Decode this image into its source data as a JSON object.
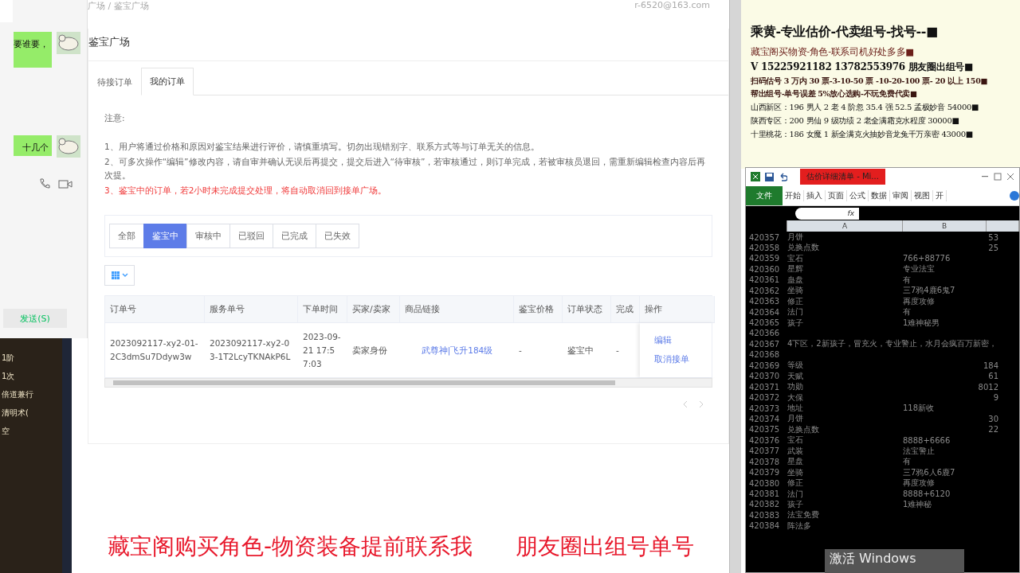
{
  "chat": {
    "messages": [
      {
        "text": "要谁要，"
      },
      {
        "text": "十几个"
      }
    ],
    "send_button": "发送(S)"
  },
  "game_panel": {
    "lines": [
      "1阶",
      "1次",
      "倍道兼行",
      "清明术(",
      "空"
    ]
  },
  "browser": {
    "breadcrumb": "广场 / 鉴宝广场",
    "user_email": "r-6520@163.com",
    "page_title": "鉴宝广场",
    "tabs": [
      {
        "label": "待接订单",
        "selected": false
      },
      {
        "label": "我的订单",
        "selected": true
      }
    ],
    "notice": {
      "heading": "注意:",
      "lines": [
        {
          "text": "1、用户将通过价格和原因对鉴宝结果进行评价，请慎重填写。切勿出现错别字、联系方式等与订单无关的信息。",
          "warning": false
        },
        {
          "text": "2、可多次操作“编辑”修改内容，请自审并确认无误后再提交，提交后进入“待审核”，若审核通过，则订单完成，若被审核员退回，需重新编辑检查内容后再次提。",
          "warning": false
        },
        {
          "text": "3、鉴宝中的订单，若2小时未完成提交处理，将自动取消回到接单广场。",
          "warning": true
        }
      ]
    },
    "filters": [
      {
        "label": "全部",
        "selected": false
      },
      {
        "label": "鉴宝中",
        "selected": true
      },
      {
        "label": "审核中",
        "selected": false
      },
      {
        "label": "已驳回",
        "selected": false
      },
      {
        "label": "已完成",
        "selected": false
      },
      {
        "label": "已失效",
        "selected": false
      }
    ],
    "table": {
      "columns": [
        "订单号",
        "服务单号",
        "下单时间",
        "买家/卖家",
        "商品链接",
        "鉴宝价格",
        "订单状态",
        "完成",
        "操作"
      ],
      "rows": [
        {
          "order_no": "2023092117-xy2-01-2C3dmSu7Ddyw3w",
          "service_no": "2023092117-xy2-03-1T2LcyTKNAkP6L",
          "time": "2023-09-21 17:57:03",
          "role": "卖家身份",
          "link": "武尊神|飞升184级",
          "price": "-",
          "status": "鉴宝中",
          "done": "-",
          "actions": [
            "编辑",
            "取消接单"
          ]
        }
      ]
    }
  },
  "ad_panel": {
    "lines": [
      {
        "text": "乘黄-专业估价-代卖组号-找号--■",
        "kind": "title"
      },
      {
        "text": "藏宝阁买物资-角色-联系司机好处多多■",
        "kind": "accent"
      },
      {
        "text": "V 15225921182   13782553976 朋友圈出组号■",
        "kind": "bold"
      },
      {
        "text": "扫码估号 3 万内 30 票-3-10-50 票 -10-20-100 票- 20 以上 150■",
        "kind": "small"
      },
      {
        "text": "帮出组号-单号误差 5%放心选购-不玩免费代卖■",
        "kind": "small"
      },
      {
        "text": "山西新区：196 男人 2 老 4 阶忽 35.4 强 52.5 孟极妙音 54000■",
        "kind": "plain"
      },
      {
        "text": "陕西专区：200 男仙 9 级功绩 2 老全满霜克水程度 30000■",
        "kind": "plain"
      },
      {
        "text": "十里桃花：186 女魔 1 新全满克火抽妙音龙兔千万亲密 43000■",
        "kind": "plain"
      }
    ]
  },
  "spreadsheet": {
    "title": "估价详细清单 - Mi...",
    "file_tab": "文件",
    "ribbon_tabs": [
      "开始",
      "插入",
      "页面",
      "公式",
      "数据",
      "审阅",
      "视图",
      "开"
    ],
    "formula_label": "fx",
    "columns": [
      "A",
      "B"
    ],
    "rows": [
      {
        "num": "420357",
        "a": "月饼",
        "b": "53",
        "kind": "number"
      },
      {
        "num": "420358",
        "a": "兑换点数",
        "b": "25",
        "kind": "number"
      },
      {
        "num": "420359",
        "a": "宝石",
        "b": "766+88776",
        "kind": "text"
      },
      {
        "num": "420360",
        "a": "星辉",
        "b": "专业法宝",
        "kind": "text"
      },
      {
        "num": "420361",
        "a": "蛊盘",
        "b": "有",
        "kind": "text"
      },
      {
        "num": "420362",
        "a": "坐骑",
        "b": "三7鸦4鹿6鬼7",
        "kind": "text"
      },
      {
        "num": "420363",
        "a": "修正",
        "b": "再度攻修",
        "kind": "text"
      },
      {
        "num": "420364",
        "a": "法门",
        "b": "有",
        "kind": "text"
      },
      {
        "num": "420365",
        "a": "孩子",
        "b": "1难神秘男",
        "kind": "text"
      },
      {
        "num": "420366"
      },
      {
        "num": "420367",
        "a": "4下区，2新孩子，冒充火，专业警止，水月会疯百万新密，"
      },
      {
        "num": "420368"
      },
      {
        "num": "420369",
        "a": "等级",
        "b": "184",
        "kind": "number"
      },
      {
        "num": "420370",
        "a": "天赋",
        "b": "61",
        "kind": "number"
      },
      {
        "num": "420371",
        "a": "功勋",
        "b": "8012",
        "kind": "number"
      },
      {
        "num": "420372",
        "a": "大保",
        "b": "9",
        "kind": "number"
      },
      {
        "num": "420373",
        "a": "地址",
        "b": "118新收",
        "kind": "text"
      },
      {
        "num": "420374",
        "a": "月饼",
        "b": "30",
        "kind": "number"
      },
      {
        "num": "420375",
        "a": "兑换点数",
        "b": "22",
        "kind": "number"
      },
      {
        "num": "420376",
        "a": "宝石",
        "b": "8888+6666",
        "kind": "text"
      },
      {
        "num": "420377",
        "a": "武装",
        "b": "法宝警止",
        "kind": "text"
      },
      {
        "num": "420378",
        "a": "星盘",
        "b": "有",
        "kind": "text"
      },
      {
        "num": "420379",
        "a": "坐骑",
        "b": "三7鸦6人6鹿7",
        "kind": "text"
      },
      {
        "num": "420380",
        "a": "修正",
        "b": "再度攻修",
        "kind": "text"
      },
      {
        "num": "420381",
        "a": "法门",
        "b": "8888+6120",
        "kind": "text"
      },
      {
        "num": "420382",
        "a": "孩子",
        "b": "1难神秘",
        "kind": "text"
      },
      {
        "num": "420383",
        "a": "法宝免费"
      },
      {
        "num": "420384",
        "a": "阵法多"
      }
    ]
  },
  "caption": {
    "left": "藏宝阁购买角色-物资装备提前联系我",
    "right": "朋友圈出组号单号"
  },
  "os_notice": "激活 Windows"
}
